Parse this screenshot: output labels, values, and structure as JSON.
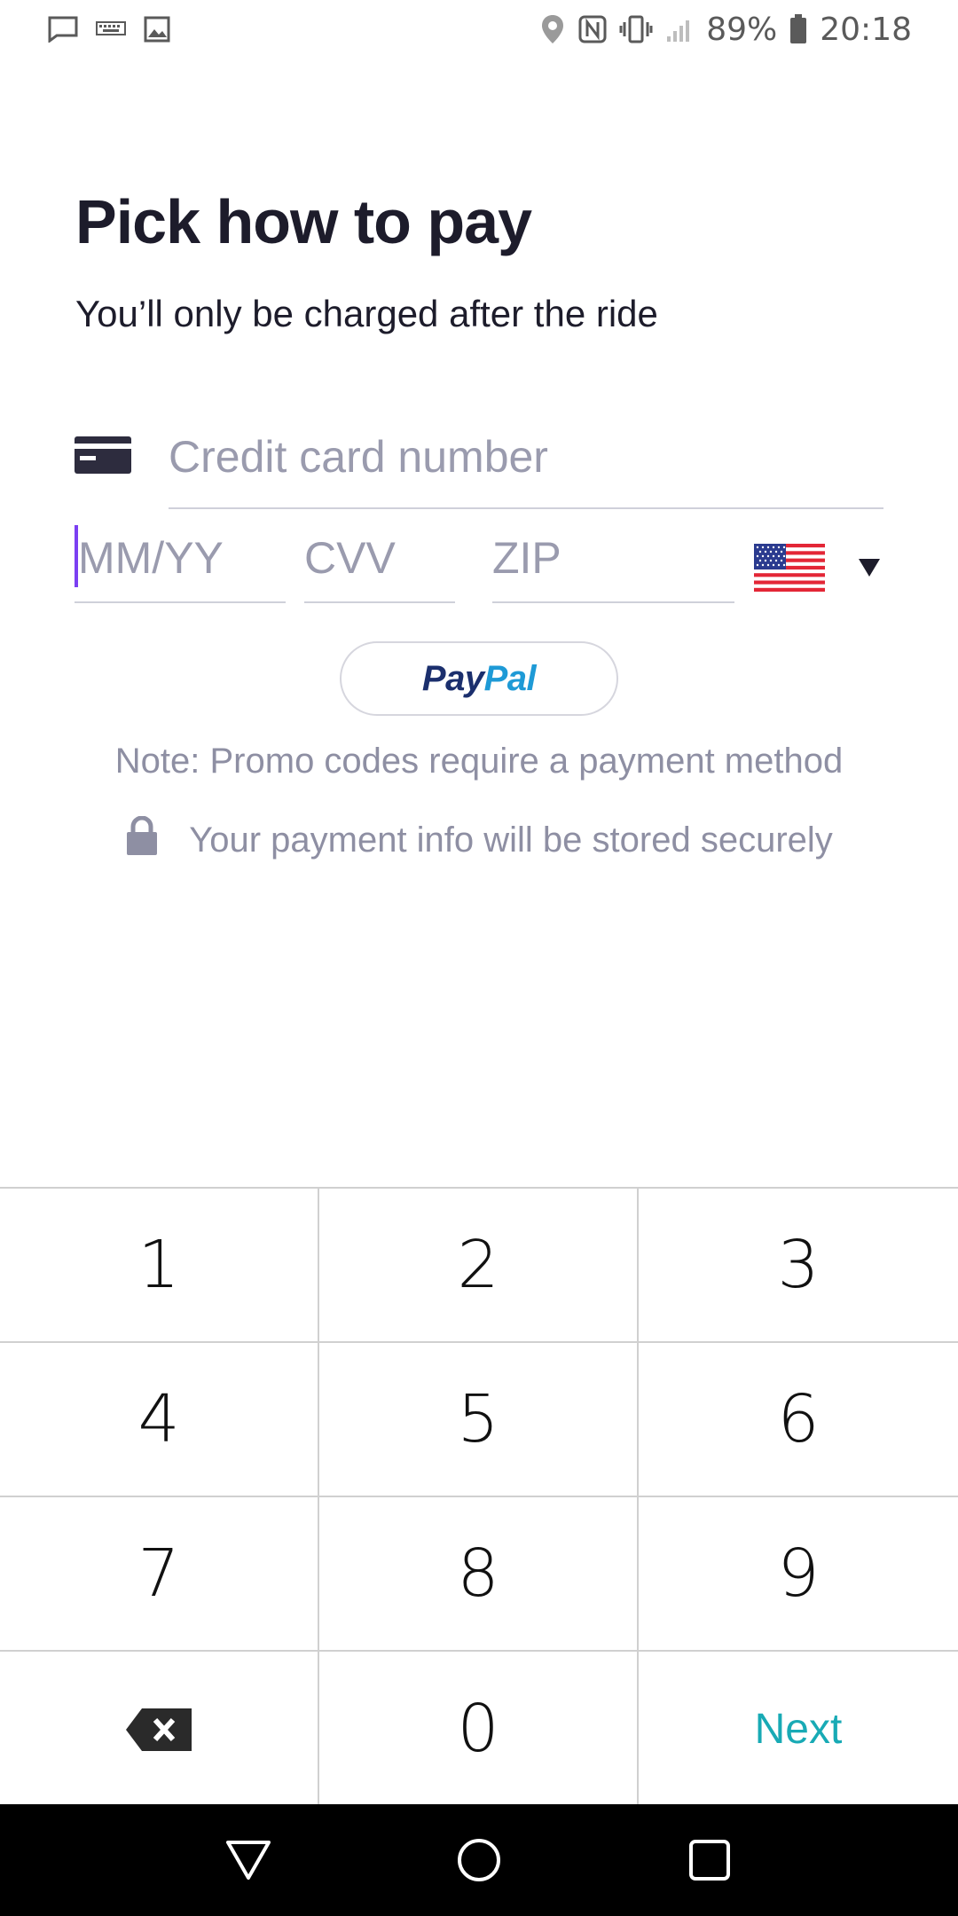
{
  "status_bar": {
    "battery": "89%",
    "time": "20:18",
    "icons_left": [
      "message-icon",
      "keyboard-icon",
      "image-icon"
    ],
    "icons_right": [
      "location-icon",
      "nfc-icon",
      "vibrate-icon",
      "signal-icon",
      "battery-icon"
    ]
  },
  "header": {
    "title": "Pick how to pay",
    "subtitle": "You’ll only be charged after the ride"
  },
  "form": {
    "card_number": {
      "placeholder": "Credit card number",
      "value": ""
    },
    "expiry": {
      "placeholder": "MM/YY",
      "value": ""
    },
    "cvv": {
      "placeholder": "CVV",
      "value": ""
    },
    "zip": {
      "placeholder": "ZIP",
      "value": ""
    },
    "country": {
      "selected": "us-flag-icon"
    }
  },
  "paypal": {
    "label_part1": "Pay",
    "label_part2": "Pal"
  },
  "note": "Note: Promo codes require a payment method",
  "secure_text": "Your payment info will be stored securely",
  "keypad": {
    "keys": [
      "1",
      "2",
      "3",
      "4",
      "5",
      "6",
      "7",
      "8",
      "9"
    ],
    "zero": "0",
    "next_label": "Next"
  },
  "colors": {
    "text_dark": "#1d1c2b",
    "placeholder": "#9a9bae",
    "caret": "#7b3ff2",
    "next": "#18aab5",
    "paypal_dark": "#1b2f6d",
    "paypal_light": "#1e9ad6"
  }
}
